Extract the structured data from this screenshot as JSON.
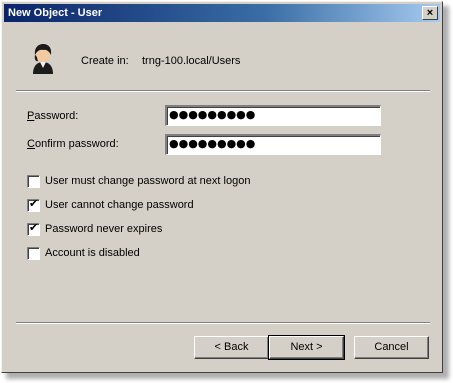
{
  "window": {
    "title": "New Object - User",
    "close_glyph": "×"
  },
  "header": {
    "icon": "user-icon",
    "create_label": "Create in:",
    "create_value": "trng-100.local/Users"
  },
  "fields": {
    "password": {
      "label": "Password:",
      "value": "●●●●●●●●●"
    },
    "confirm": {
      "label": "Confirm password:",
      "value": "●●●●●●●●●"
    }
  },
  "options": [
    {
      "label": "User must change password at next logon",
      "checked": false
    },
    {
      "label": "User cannot change password",
      "checked": true
    },
    {
      "label": "Password never expires",
      "checked": true
    },
    {
      "label": "Account is disabled",
      "checked": false
    }
  ],
  "buttons": {
    "back": "< Back",
    "next": "Next >",
    "cancel": "Cancel"
  }
}
